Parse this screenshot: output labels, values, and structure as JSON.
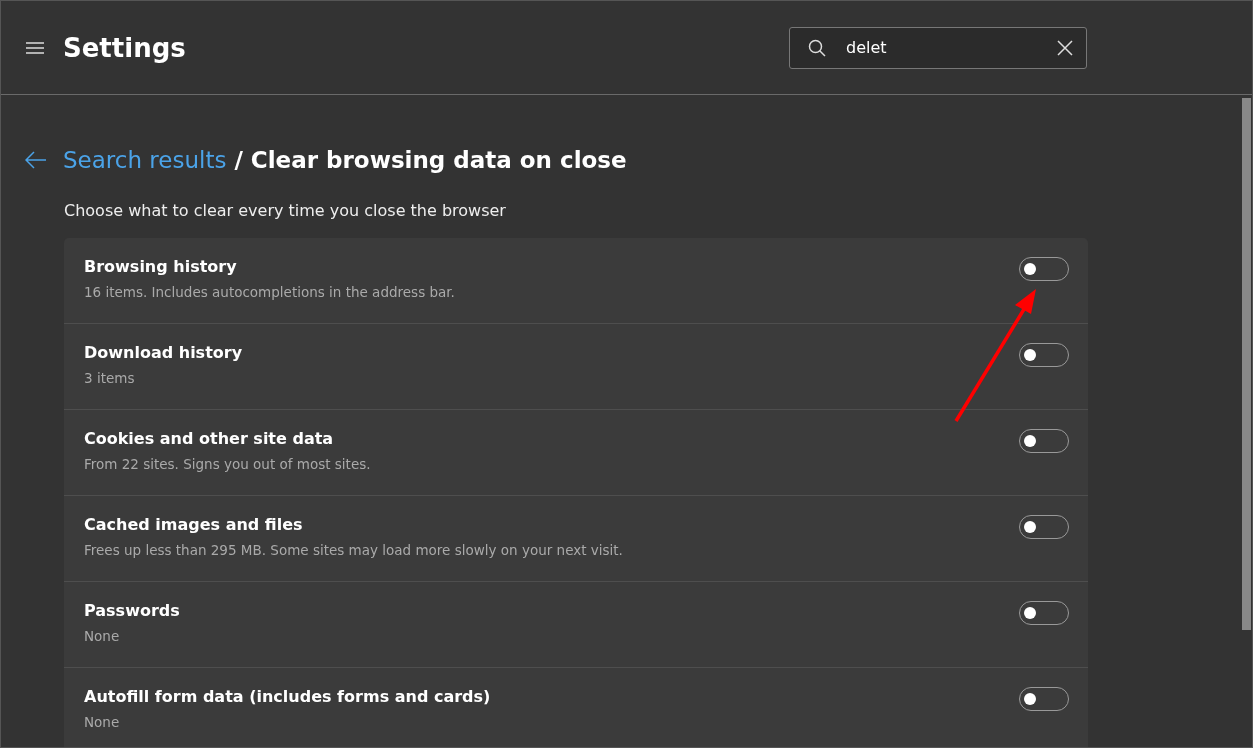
{
  "header": {
    "title": "Settings",
    "search": {
      "value": "delet"
    }
  },
  "breadcrumb": {
    "link": "Search results",
    "separator": "/",
    "current": "Clear browsing data on close"
  },
  "intro": "Choose what to clear every time you close the browser",
  "options": [
    {
      "title": "Browsing history",
      "detail": "16 items. Includes autocompletions in the address bar.",
      "on": false
    },
    {
      "title": "Download history",
      "detail": "3 items",
      "on": false
    },
    {
      "title": "Cookies and other site data",
      "detail": "From 22 sites. Signs you out of most sites.",
      "on": false
    },
    {
      "title": "Cached images and files",
      "detail": "Frees up less than 295 MB. Some sites may load more slowly on your next visit.",
      "on": false
    },
    {
      "title": "Passwords",
      "detail": "None",
      "on": false
    },
    {
      "title": "Autofill form data (includes forms and cards)",
      "detail": "None",
      "on": false
    }
  ]
}
